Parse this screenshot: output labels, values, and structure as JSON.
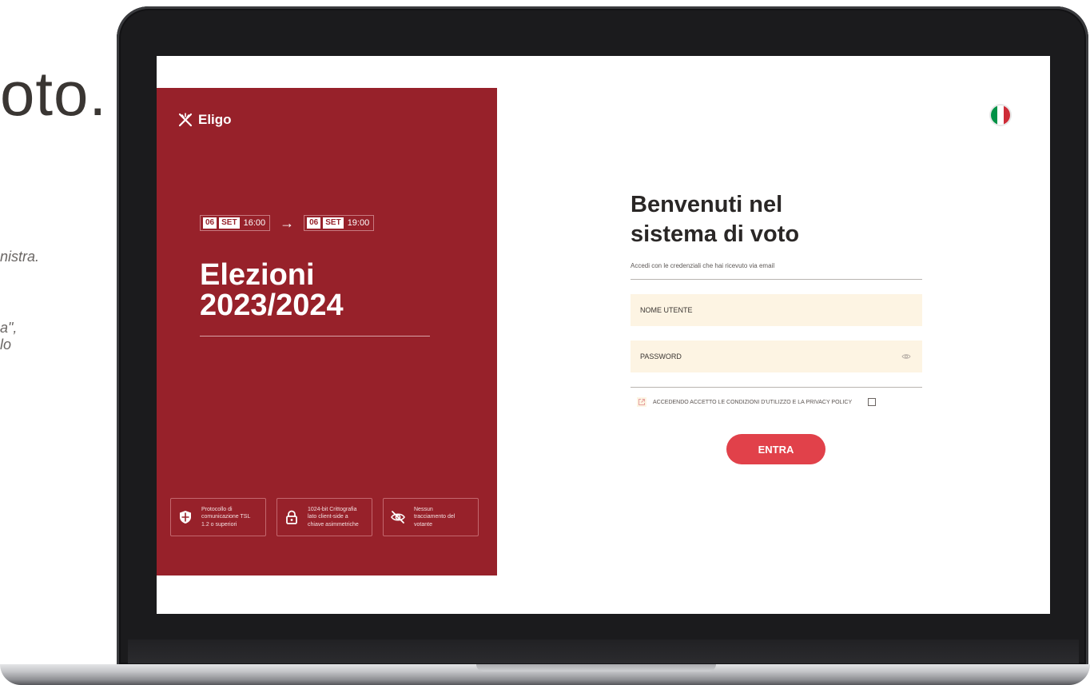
{
  "slide": {
    "heading": "oto.",
    "line1": "nistra.",
    "line2": "a\",",
    "line3": "lo"
  },
  "brand": {
    "name": "Eligo"
  },
  "election": {
    "start": {
      "day": "06",
      "month": "SET",
      "time": "16:00"
    },
    "end": {
      "day": "06",
      "month": "SET",
      "time": "19:00"
    },
    "arrow": "→",
    "title_line1": "Elezioni",
    "title_line2": "2023/2024"
  },
  "features": [
    {
      "icon": "shield-icon",
      "text": [
        "Protocollo di",
        "comunicazione TSL",
        "1.2 o superiori"
      ]
    },
    {
      "icon": "lock-icon",
      "text": [
        "1024-bit Crittografia",
        "lato client-side a",
        "chiave asimmetriche"
      ]
    },
    {
      "icon": "eye-off-icon",
      "text": [
        "Nessun",
        "tracciamento del",
        "votante"
      ]
    }
  ],
  "language": {
    "icon": "italy-flag-icon",
    "colors": [
      "#009246",
      "#ffffff",
      "#ce2b37"
    ]
  },
  "login": {
    "title_line1": "Benvenuti nel",
    "title_line2": "sistema di voto",
    "subtitle": "Accedi con le credenziali che hai ricevuto via email",
    "username_placeholder": "NOME UTENTE",
    "password_placeholder": "PASSWORD",
    "terms": "ACCEDENDO ACCETTO LE CONDIZIONI D'UTILIZZO E LA PRIVACY POLICY",
    "submit": "ENTRA"
  },
  "colors": {
    "panel": "#97212a",
    "accent_button": "#e1414a",
    "field_bg": "#fdf4e3"
  }
}
